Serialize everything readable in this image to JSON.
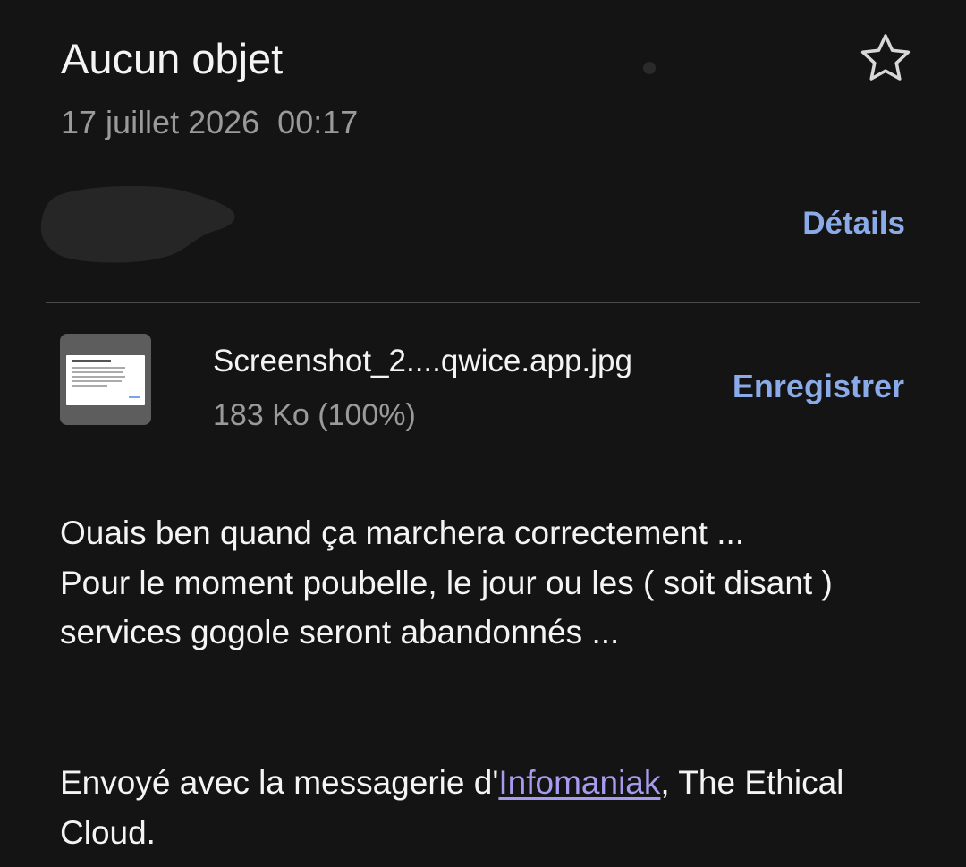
{
  "email": {
    "subject": "Aucun objet",
    "datetime": "17 juillet 2026  00:17",
    "details_label": "Détails",
    "star_icon": "star-outline-icon"
  },
  "attachment": {
    "file_name": "Screenshot_2....qwice.app.jpg",
    "file_size": "183 Ko (100%)",
    "save_label": "Enregistrer",
    "thumbnail_icon": "image-thumbnail-icon"
  },
  "body": {
    "lines": [
      "Ouais ben quand ça marchera correctement ...",
      "Pour le moment poubelle, le jour ou les ( soit disant ) services gogole seront abandonnés ..."
    ]
  },
  "signature": {
    "prefix": "Envoyé avec la messagerie d'",
    "link_text": "Infomaniak",
    "suffix": ", The Ethical Cloud."
  },
  "colors": {
    "background": "#141414",
    "accent_link": "#8aaae8",
    "signature_link": "#a79bf0",
    "muted_text": "#9a9a9a"
  }
}
